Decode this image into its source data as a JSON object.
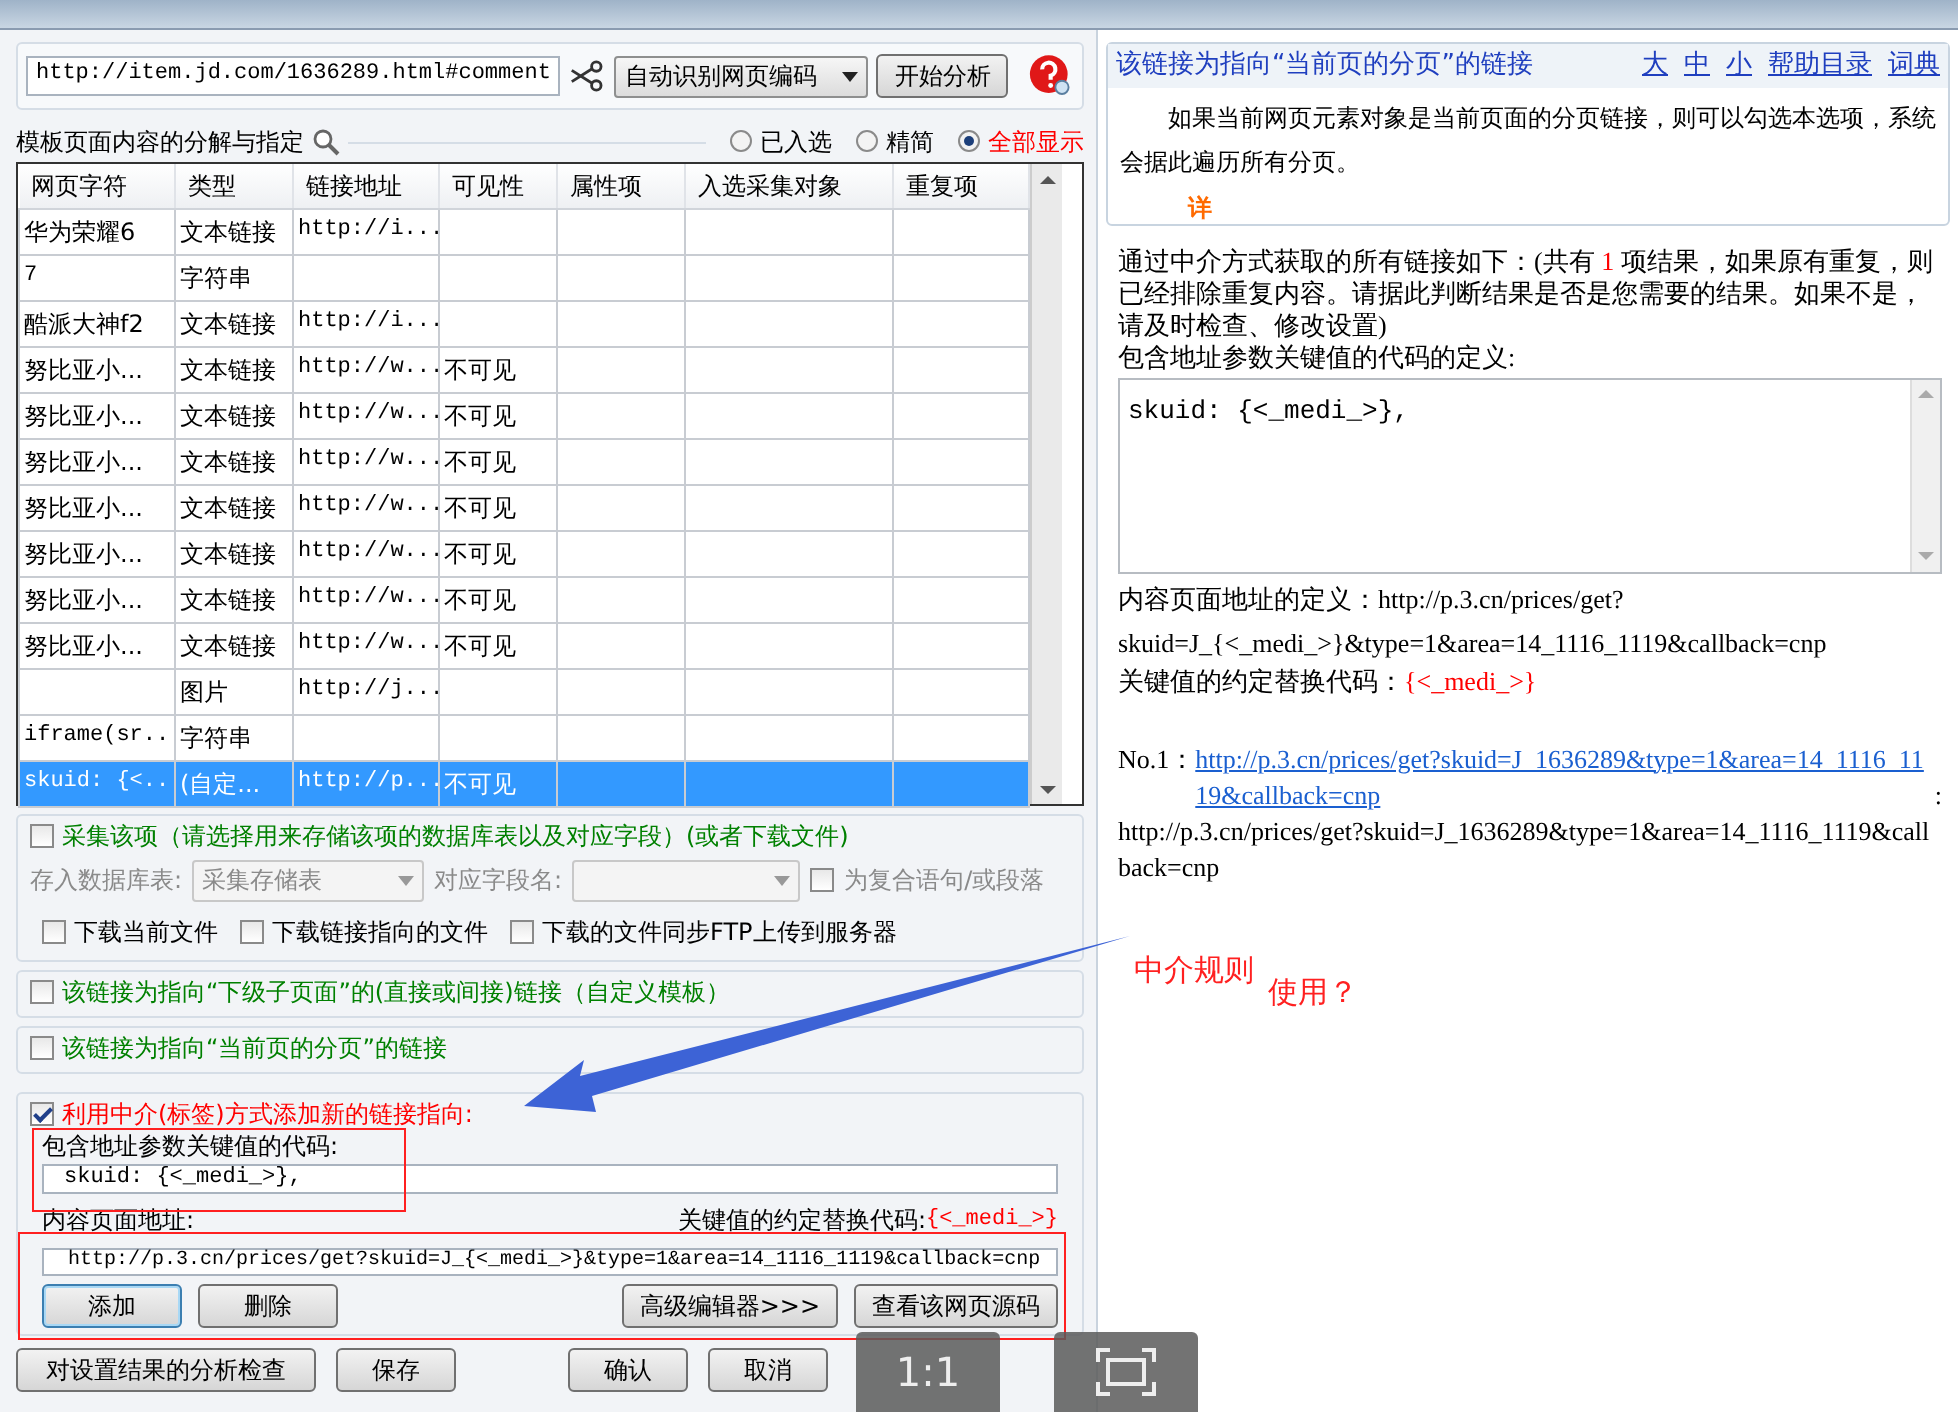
{
  "toolbar": {
    "url": "http://item.jd.com/1636289.html#comment",
    "encoding": "自动识别网页编码",
    "analyze_button": "开始分析"
  },
  "decompose": {
    "title": "模板页面内容的分解与指定",
    "filters": [
      {
        "label": "已入选",
        "selected": false
      },
      {
        "label": "精简",
        "selected": false
      },
      {
        "label": "全部显示",
        "selected": true
      }
    ]
  },
  "table": {
    "columns": [
      "网页字符",
      "类型",
      "链接地址",
      "可见性",
      "属性项",
      "入选采集对象",
      "重复项"
    ],
    "rows": [
      {
        "cells": [
          "华为荣耀6",
          "文本链接",
          "http://i...",
          "",
          "",
          "",
          ""
        ],
        "selected": false
      },
      {
        "cells": [
          "7",
          "字符串",
          "",
          "",
          "",
          "",
          ""
        ],
        "selected": false
      },
      {
        "cells": [
          "酷派大神f2",
          "文本链接",
          "http://i...",
          "",
          "",
          "",
          ""
        ],
        "selected": false
      },
      {
        "cells": [
          "努比亚小...",
          "文本链接",
          "http://w...",
          "不可见",
          "",
          "",
          ""
        ],
        "selected": false
      },
      {
        "cells": [
          "努比亚小...",
          "文本链接",
          "http://w...",
          "不可见",
          "",
          "",
          ""
        ],
        "selected": false
      },
      {
        "cells": [
          "努比亚小...",
          "文本链接",
          "http://w...",
          "不可见",
          "",
          "",
          ""
        ],
        "selected": false
      },
      {
        "cells": [
          "努比亚小...",
          "文本链接",
          "http://w...",
          "不可见",
          "",
          "",
          ""
        ],
        "selected": false
      },
      {
        "cells": [
          "努比亚小...",
          "文本链接",
          "http://w...",
          "不可见",
          "",
          "",
          ""
        ],
        "selected": false
      },
      {
        "cells": [
          "努比亚小...",
          "文本链接",
          "http://w...",
          "不可见",
          "",
          "",
          ""
        ],
        "selected": false
      },
      {
        "cells": [
          "努比亚小...",
          "文本链接",
          "http://w...",
          "不可见",
          "",
          "",
          ""
        ],
        "selected": false
      },
      {
        "cells": [
          "",
          "图片",
          "http://j...",
          "",
          "",
          "",
          ""
        ],
        "selected": false
      },
      {
        "cells": [
          "iframe(sr...",
          "字符串",
          "",
          "",
          "",
          "",
          ""
        ],
        "selected": false
      },
      {
        "cells": [
          "skuid: {<...",
          "(自定...",
          "http://p...",
          "不可见",
          "",
          "",
          ""
        ],
        "selected": true
      }
    ]
  },
  "collect": {
    "checked": false,
    "label": "采集该项（请选择用来存储该项的数据库表以及对应字段）(或者下载文件)",
    "disabled": true,
    "db_label": "存入数据库表:",
    "db_value": "采集存储表",
    "field_label": "对应字段名:",
    "compound": {
      "label": "为复合语句/或段落",
      "checked": false
    },
    "downloads": [
      {
        "label": "下载当前文件",
        "checked": false
      },
      {
        "label": "下载链接指向的文件",
        "checked": false
      },
      {
        "label": "下载的文件同步FTP上传到服务器",
        "checked": false
      }
    ]
  },
  "options": [
    {
      "label": "该链接为指向“下级子页面”的(直接或间接)链接（自定义模板）",
      "checked": false
    },
    {
      "label": "该链接为指向“当前页的分页”的链接",
      "checked": false
    }
  ],
  "intermediary": {
    "checked": true,
    "label": "利用中介(标签)方式添加新的链接指向:",
    "code_label": "包含地址参数关键值的代码:",
    "code_value": "skuid: {<_medi_>},",
    "url_label": "内容页面地址:",
    "replace_label": "关键值的约定替换代码:",
    "replace_code": "{<_medi_>}",
    "url_value": "http://p.3.cn/prices/get?skuid=J_{<_medi_>}&type=1&area=14_1116_1119&callback=cnp",
    "buttons": [
      "添加",
      "删除",
      "高级编辑器>>>",
      "查看该网页源码"
    ]
  },
  "footer_buttons": [
    "对设置结果的分析检查",
    "保存",
    "确认",
    "取消"
  ],
  "viewer_controls": {
    "zoom_label": "1:1"
  },
  "help": {
    "title": "该链接为指向“当前页的分页”的链接",
    "size_links": [
      "大",
      "中",
      "小"
    ],
    "links": [
      "帮助目录",
      "词典"
    ],
    "body": "如果当前网页元素对象是当前页面的分页链接，则可以勾选本选项，系统会据此遍历所有分页。",
    "more": "详"
  },
  "result": {
    "intro_before": "通过中介方式获取的所有链接如下：(共有 ",
    "count": "1",
    "intro_after": " 项结果，如果原有重复，则已经排除重复内容。请据此判断结果是否是您需要的结果。如果不是，请及时检查、修改设置)",
    "code_def_label": "包含地址参数关键值的代码的定义:",
    "code_def_value": "skuid: {<_medi_>},",
    "url_def_label": "内容页面地址的定义：",
    "url_def_value": "http://p.3.cn/prices/get?skuid=J_{<_medi_>}&type=1&area=14_1116_1119&callback=cnp",
    "replace_label": "关键值的约定替换代码：",
    "replace_code": "{<_medi_>}",
    "entries": [
      {
        "number": "No.1：",
        "link": "http://p.3.cn/prices/get?skuid=J_1636289&type=1&area=14_1116_1119&callback=cnp",
        "separator": " :",
        "target": "http://p.3.cn/prices/get?skuid=J_1636289&type=1&area=14_1116_1119&callback=cnp"
      }
    ]
  },
  "annotation": {
    "texts": [
      "中介规则",
      "使用？"
    ]
  }
}
